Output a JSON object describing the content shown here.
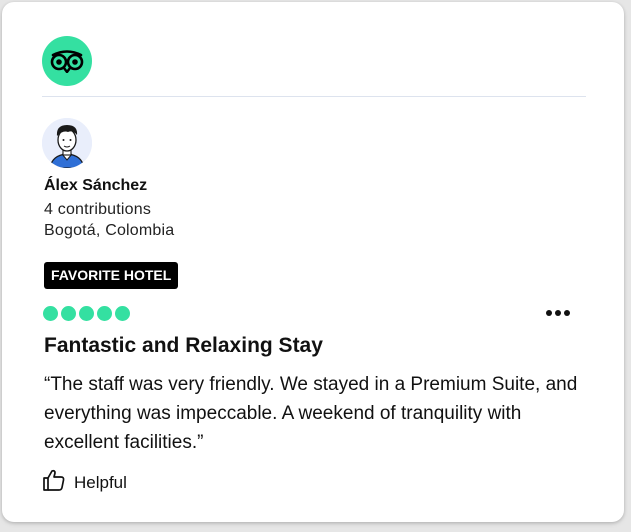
{
  "brand": {
    "logo_icon": "tripadvisor-owl-icon",
    "accent_color": "#34e0a1"
  },
  "reviewer": {
    "avatar_icon": "user-avatar-icon",
    "name": "Álex Sánchez",
    "contributions": "4 contributions",
    "location": "Bogotá, Colombia"
  },
  "badge": {
    "label": "FAVORITE HOTEL"
  },
  "review": {
    "rating": 5,
    "rating_max": 5,
    "more_icon": "more-options-icon",
    "title": "Fantastic and Relaxing Stay",
    "text": "“The staff was very friendly. We stayed in a Premium Suite, and everything was impeccable. A weekend of tranquility with excellent facilities.”"
  },
  "actions": {
    "helpful_icon": "thumbs-up-icon",
    "helpful_label": "Helpful"
  }
}
